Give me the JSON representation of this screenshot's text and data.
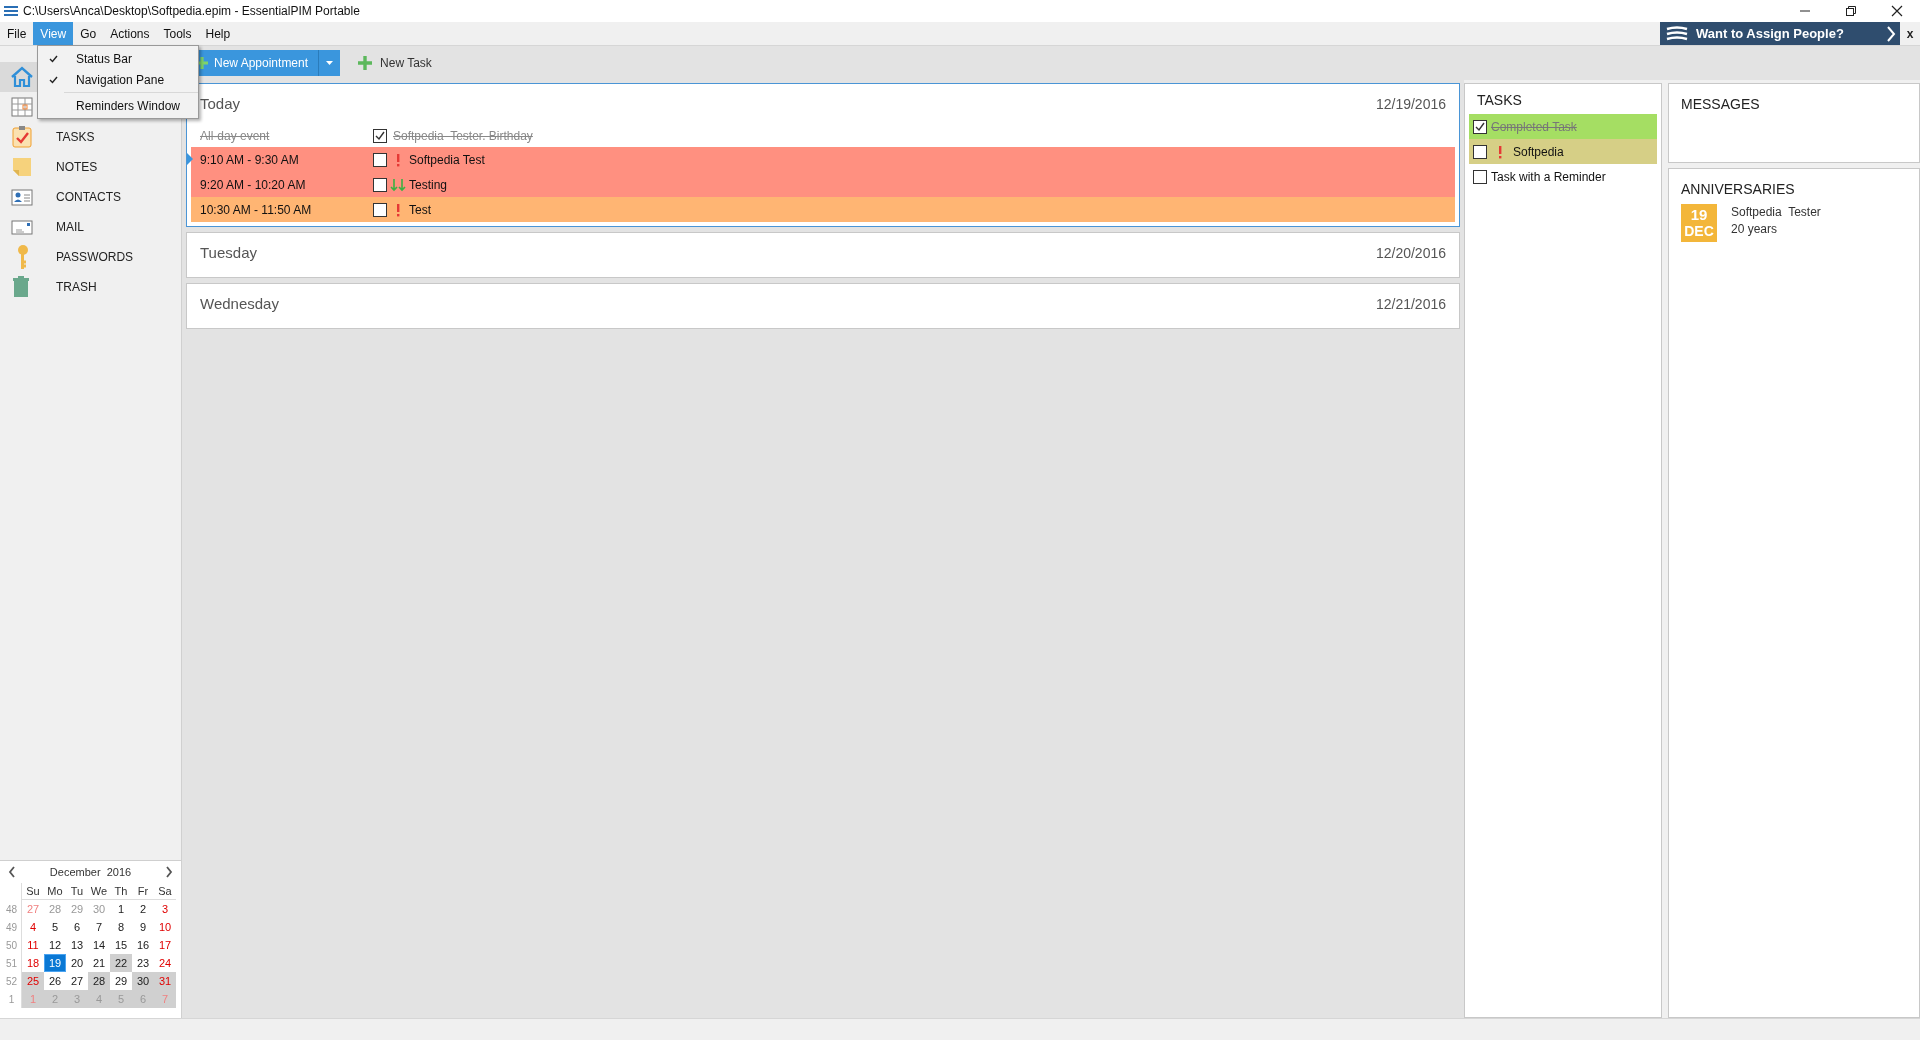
{
  "window": {
    "title": "C:\\Users\\Anca\\Desktop\\Softpedia.epim - EssentialPIM Portable"
  },
  "menu": [
    {
      "label": "File",
      "selected": false
    },
    {
      "label": "View",
      "selected": true
    },
    {
      "label": "Go",
      "selected": false
    },
    {
      "label": "Actions",
      "selected": false
    },
    {
      "label": "Tools",
      "selected": false
    },
    {
      "label": "Help",
      "selected": false
    }
  ],
  "view_menu": [
    {
      "label": "Status Bar",
      "checked": true
    },
    {
      "label": "Navigation Pane",
      "checked": true
    },
    {
      "label": "Reminders Window",
      "checked": false
    }
  ],
  "banner": {
    "text": "Want to Assign People?",
    "close": "x"
  },
  "toolbar": {
    "new_appointment": "New Appointment",
    "new_task": "New Task"
  },
  "nav": [
    {
      "kind": "home",
      "selected": true
    },
    {
      "kind": "calendar",
      "selected": false
    },
    {
      "kind": "tasks",
      "label": "TASKS",
      "selected": false
    },
    {
      "kind": "notes",
      "label": "NOTES",
      "selected": false
    },
    {
      "kind": "contacts",
      "label": "CONTACTS",
      "selected": false
    },
    {
      "kind": "mail",
      "label": "MAIL",
      "selected": false
    },
    {
      "kind": "passwords",
      "label": "PASSWORDS",
      "selected": false
    },
    {
      "kind": "trash",
      "label": "TRASH",
      "selected": false
    }
  ],
  "mini_calendar": {
    "title": "December  2016",
    "weekdays": [
      "Su",
      "Mo",
      "Tu",
      "We",
      "Th",
      "Fr",
      "Sa"
    ],
    "weeks": [
      {
        "number": "48",
        "days": [
          {
            "t": "27",
            "muted": true,
            "weekend": true,
            "selected": false,
            "shaded": false
          },
          {
            "t": "28",
            "muted": true,
            "weekend": false,
            "selected": false,
            "shaded": false
          },
          {
            "t": "29",
            "muted": true,
            "weekend": false,
            "selected": false,
            "shaded": false
          },
          {
            "t": "30",
            "muted": true,
            "weekend": false,
            "selected": false,
            "shaded": false
          },
          {
            "t": "1",
            "muted": false,
            "weekend": false,
            "selected": false,
            "shaded": false
          },
          {
            "t": "2",
            "muted": false,
            "weekend": false,
            "selected": false,
            "shaded": false
          },
          {
            "t": "3",
            "muted": false,
            "weekend": true,
            "selected": false,
            "shaded": false
          }
        ]
      },
      {
        "number": "49",
        "days": [
          {
            "t": "4",
            "muted": false,
            "weekend": true,
            "selected": false,
            "shaded": false
          },
          {
            "t": "5",
            "muted": false,
            "weekend": false,
            "selected": false,
            "shaded": false
          },
          {
            "t": "6",
            "muted": false,
            "weekend": false,
            "selected": false,
            "shaded": false
          },
          {
            "t": "7",
            "muted": false,
            "weekend": false,
            "selected": false,
            "shaded": false
          },
          {
            "t": "8",
            "muted": false,
            "weekend": false,
            "selected": false,
            "shaded": false
          },
          {
            "t": "9",
            "muted": false,
            "weekend": false,
            "selected": false,
            "shaded": false
          },
          {
            "t": "10",
            "muted": false,
            "weekend": true,
            "selected": false,
            "shaded": false
          }
        ]
      },
      {
        "number": "50",
        "days": [
          {
            "t": "11",
            "muted": false,
            "weekend": true,
            "selected": false,
            "shaded": false
          },
          {
            "t": "12",
            "muted": false,
            "weekend": false,
            "selected": false,
            "shaded": false
          },
          {
            "t": "13",
            "muted": false,
            "weekend": false,
            "selected": false,
            "shaded": false
          },
          {
            "t": "14",
            "muted": false,
            "weekend": false,
            "selected": false,
            "shaded": false
          },
          {
            "t": "15",
            "muted": false,
            "weekend": false,
            "selected": false,
            "shaded": false
          },
          {
            "t": "16",
            "muted": false,
            "weekend": false,
            "selected": false,
            "shaded": false
          },
          {
            "t": "17",
            "muted": false,
            "weekend": true,
            "selected": false,
            "shaded": false
          }
        ]
      },
      {
        "number": "51",
        "days": [
          {
            "t": "18",
            "muted": false,
            "weekend": true,
            "selected": false,
            "shaded": false
          },
          {
            "t": "19",
            "muted": false,
            "weekend": false,
            "selected": true,
            "shaded": false
          },
          {
            "t": "20",
            "muted": false,
            "weekend": false,
            "selected": false,
            "shaded": false
          },
          {
            "t": "21",
            "muted": false,
            "weekend": false,
            "selected": false,
            "shaded": false
          },
          {
            "t": "22",
            "muted": false,
            "weekend": false,
            "selected": false,
            "shaded": true
          },
          {
            "t": "23",
            "muted": false,
            "weekend": false,
            "selected": false,
            "shaded": false
          },
          {
            "t": "24",
            "muted": false,
            "weekend": true,
            "selected": false,
            "shaded": false
          }
        ]
      },
      {
        "number": "52",
        "days": [
          {
            "t": "25",
            "muted": false,
            "weekend": true,
            "selected": false,
            "shaded": true
          },
          {
            "t": "26",
            "muted": false,
            "weekend": false,
            "selected": false,
            "shaded": false
          },
          {
            "t": "27",
            "muted": false,
            "weekend": false,
            "selected": false,
            "shaded": false
          },
          {
            "t": "28",
            "muted": false,
            "weekend": false,
            "selected": false,
            "shaded": true
          },
          {
            "t": "29",
            "muted": false,
            "weekend": false,
            "selected": false,
            "shaded": false
          },
          {
            "t": "30",
            "muted": false,
            "weekend": false,
            "selected": false,
            "shaded": true
          },
          {
            "t": "31",
            "muted": false,
            "weekend": true,
            "selected": false,
            "shaded": true
          }
        ]
      },
      {
        "number": "1",
        "days": [
          {
            "t": "1",
            "muted": true,
            "weekend": true,
            "selected": false,
            "shaded": true
          },
          {
            "t": "2",
            "muted": true,
            "weekend": false,
            "selected": false,
            "shaded": true
          },
          {
            "t": "3",
            "muted": true,
            "weekend": false,
            "selected": false,
            "shaded": true
          },
          {
            "t": "4",
            "muted": true,
            "weekend": false,
            "selected": false,
            "shaded": true
          },
          {
            "t": "5",
            "muted": true,
            "weekend": false,
            "selected": false,
            "shaded": true
          },
          {
            "t": "6",
            "muted": true,
            "weekend": false,
            "selected": false,
            "shaded": true
          },
          {
            "t": "7",
            "muted": true,
            "weekend": true,
            "selected": false,
            "shaded": true
          }
        ]
      }
    ]
  },
  "days": [
    {
      "name": "Today",
      "date": "12/19/2016",
      "selected": true,
      "all_day": {
        "label": "All-day event",
        "title": "Softpedia  Tester. Birthday",
        "checked": true
      },
      "appointments": [
        {
          "time": "9:10 AM - 9:30 AM",
          "title": "Softpedia Test",
          "checked": false,
          "high_priority": true,
          "low_priority": false,
          "color": "#ff9080",
          "selected": true
        },
        {
          "time": "9:20 AM - 10:20 AM",
          "title": "Testing",
          "checked": false,
          "high_priority": false,
          "low_priority": true,
          "color": "#ff9080",
          "selected": false
        },
        {
          "time": "10:30 AM - 11:50 AM",
          "title": "Test",
          "checked": false,
          "high_priority": true,
          "low_priority": false,
          "color": "#ffb573",
          "selected": false
        }
      ]
    },
    {
      "name": "Tuesday",
      "date": "12/20/2016",
      "selected": false
    },
    {
      "name": "Wednesday",
      "date": "12/21/2016",
      "selected": false
    }
  ],
  "tasks": {
    "title": "TASKS",
    "items": [
      {
        "title": "Completed Task",
        "checked": true,
        "high_priority": false,
        "color": "#a5de63"
      },
      {
        "title": "Softpedia",
        "checked": false,
        "high_priority": true,
        "color": "#d6cf86"
      },
      {
        "title": "Task with a Reminder",
        "checked": false,
        "high_priority": false,
        "color": "#ffffff"
      }
    ]
  },
  "messages": {
    "title": "MESSAGES"
  },
  "anniversaries": {
    "title": "ANNIVERSARIES",
    "items": [
      {
        "day": "19",
        "month": "DEC",
        "name": "Softpedia  Tester",
        "years": "20 years"
      }
    ]
  }
}
